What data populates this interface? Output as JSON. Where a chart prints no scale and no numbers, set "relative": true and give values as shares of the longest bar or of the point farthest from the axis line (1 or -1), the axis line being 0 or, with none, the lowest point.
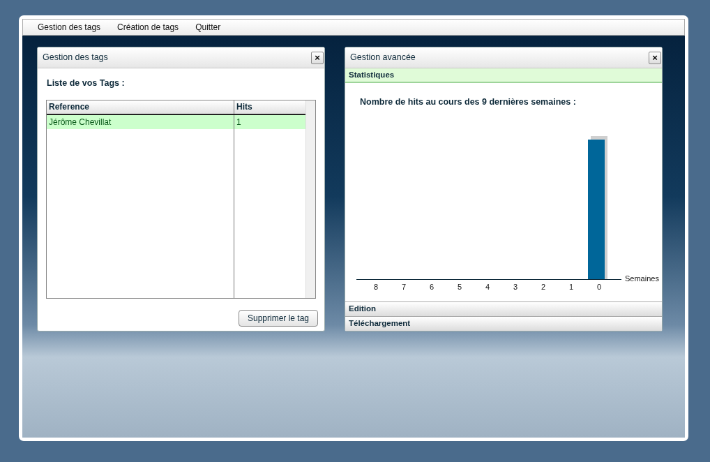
{
  "menu": [
    {
      "label": "Gestion des tags"
    },
    {
      "label": "Création de tags"
    },
    {
      "label": "Quitter"
    }
  ],
  "tags_panel": {
    "title": "Gestion des tags",
    "close": "×",
    "heading": "Liste de vos Tags :",
    "table": {
      "columns": [
        "Reference",
        "Hits"
      ],
      "rows": [
        {
          "cells": [
            "Jérôme Chevillat",
            "1"
          ],
          "selected": true
        }
      ]
    },
    "delete_button": "Supprimer le tag"
  },
  "advanced_panel": {
    "title": "Gestion avancée",
    "close": "×",
    "sections": [
      {
        "label": "Statistiques",
        "expanded": true
      },
      {
        "label": "Edition",
        "expanded": false
      },
      {
        "label": "Téléchargement",
        "expanded": false
      }
    ],
    "chart_title": "Nombre de hits au cours des 9 dernières semaines :",
    "chart_data": {
      "type": "bar",
      "xlabel": "Semaines",
      "categories": [
        "8",
        "7",
        "6",
        "5",
        "4",
        "3",
        "2",
        "1",
        "0"
      ],
      "relative": true,
      "series": [
        {
          "color": "#006699",
          "values": [
            0,
            0,
            0,
            0,
            0,
            0,
            0,
            0,
            1
          ]
        }
      ]
    }
  }
}
